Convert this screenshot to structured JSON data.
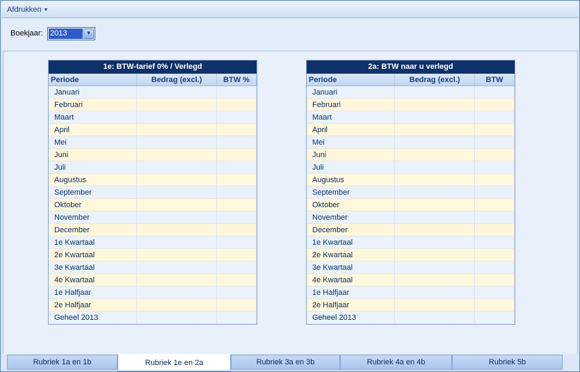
{
  "menu": {
    "afdrukken": "Afdrukken"
  },
  "filter": {
    "label": "Boekjaar:",
    "year": "2013"
  },
  "panels": [
    {
      "title": "1e: BTW-tarief  0% / Verlegd",
      "columns": [
        "Periode",
        "Bedrag (excl.)",
        "BTW %"
      ]
    },
    {
      "title": "2a: BTW naar u verlegd",
      "columns": [
        "Periode",
        "Bedrag (excl.)",
        "BTW"
      ]
    }
  ],
  "periods": [
    "Januari",
    "Februari",
    "Maart",
    "April",
    "Mei",
    "Juni",
    "Juli",
    "Augustus",
    "September",
    "Oktober",
    "November",
    "December",
    "1e Kwartaal",
    "2e Kwartaal",
    "3e Kwartaal",
    "4e Kwartaal",
    "1e Halfjaar",
    "2e Halfjaar",
    "Geheel 2013"
  ],
  "tabs": [
    "Rubriek 1a en 1b",
    "Rubriek 1e en 2a",
    "Rubriek 3a en 3b",
    "Rubriek 4a en 4b",
    "Rubriek 5b"
  ],
  "active_tab": "Rubriek 1e en 2a"
}
